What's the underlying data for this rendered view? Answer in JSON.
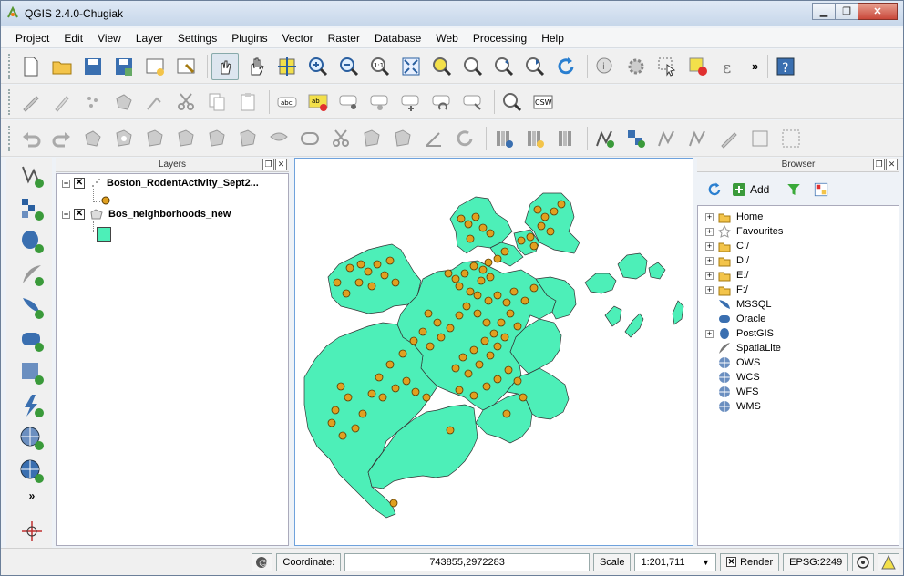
{
  "window": {
    "title": "QGIS 2.4.0-Chugiak"
  },
  "menu": [
    "Project",
    "Edit",
    "View",
    "Layer",
    "Settings",
    "Plugins",
    "Vector",
    "Raster",
    "Database",
    "Web",
    "Processing",
    "Help"
  ],
  "toolbar_more": "»",
  "layers_panel": {
    "title": "Layers",
    "layers": [
      {
        "name": "Boston_RodentActivity_Sept2...",
        "checked": true,
        "symbol": "point",
        "color": "#e0a020"
      },
      {
        "name": "Bos_neighborhoods_new",
        "checked": true,
        "symbol": "polygon",
        "color": "#4def b8"
      }
    ]
  },
  "browser_panel": {
    "title": "Browser",
    "add_label": "Add",
    "items": [
      {
        "label": "Home",
        "icon": "folder-icon",
        "expandable": true
      },
      {
        "label": "Favourites",
        "icon": "star-icon",
        "expandable": true
      },
      {
        "label": "C:/",
        "icon": "folder-icon",
        "expandable": true
      },
      {
        "label": "D:/",
        "icon": "folder-icon",
        "expandable": true
      },
      {
        "label": "E:/",
        "icon": "folder-icon",
        "expandable": true
      },
      {
        "label": "F:/",
        "icon": "folder-icon",
        "expandable": true
      },
      {
        "label": "MSSQL",
        "icon": "mssql-icon",
        "expandable": false
      },
      {
        "label": "Oracle",
        "icon": "oracle-icon",
        "expandable": false
      },
      {
        "label": "PostGIS",
        "icon": "postgis-icon",
        "expandable": true
      },
      {
        "label": "SpatiaLite",
        "icon": "spatialite-icon",
        "expandable": false
      },
      {
        "label": "OWS",
        "icon": "globe-icon",
        "expandable": false
      },
      {
        "label": "WCS",
        "icon": "globe-icon",
        "expandable": false
      },
      {
        "label": "WFS",
        "icon": "globe-icon",
        "expandable": false
      },
      {
        "label": "WMS",
        "icon": "globe-icon",
        "expandable": false
      }
    ]
  },
  "status": {
    "coordinate_label": "Coordinate:",
    "coordinate_value": "743855,2972283",
    "scale_label": "Scale",
    "scale_value": "1:201,711",
    "render_label": "Render",
    "crs": "EPSG:2249"
  },
  "colors": {
    "land": "#4defb8",
    "points": "#e0a020",
    "points_stroke": "#5a3a00"
  }
}
